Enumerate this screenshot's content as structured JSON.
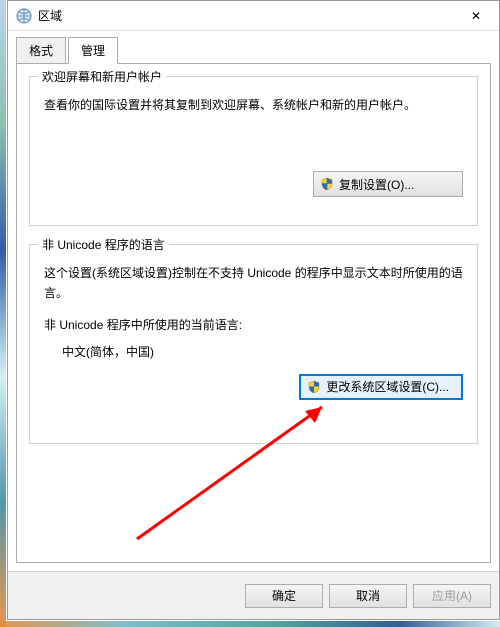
{
  "window": {
    "title": "区域",
    "close_glyph": "✕"
  },
  "tabs": {
    "format": "格式",
    "administrative": "管理"
  },
  "group1": {
    "title": "欢迎屏幕和新用户帐户",
    "desc": "查看你的国际设置并将其复制到欢迎屏幕、系统帐户和新的用户帐户。",
    "button": "复制设置(O)..."
  },
  "group2": {
    "title": "非 Unicode 程序的语言",
    "desc": "这个设置(系统区域设置)控制在不支持 Unicode 的程序中显示文本时所使用的语言。",
    "current_label": "非 Unicode 程序中所使用的当前语言:",
    "current_value": "中文(简体，中国)",
    "button": "更改系统区域设置(C)..."
  },
  "buttons": {
    "ok": "确定",
    "cancel": "取消",
    "apply": "应用(A)"
  },
  "icons": {
    "globe": "globe-icon",
    "shield": "shield-icon",
    "close": "close-icon"
  }
}
